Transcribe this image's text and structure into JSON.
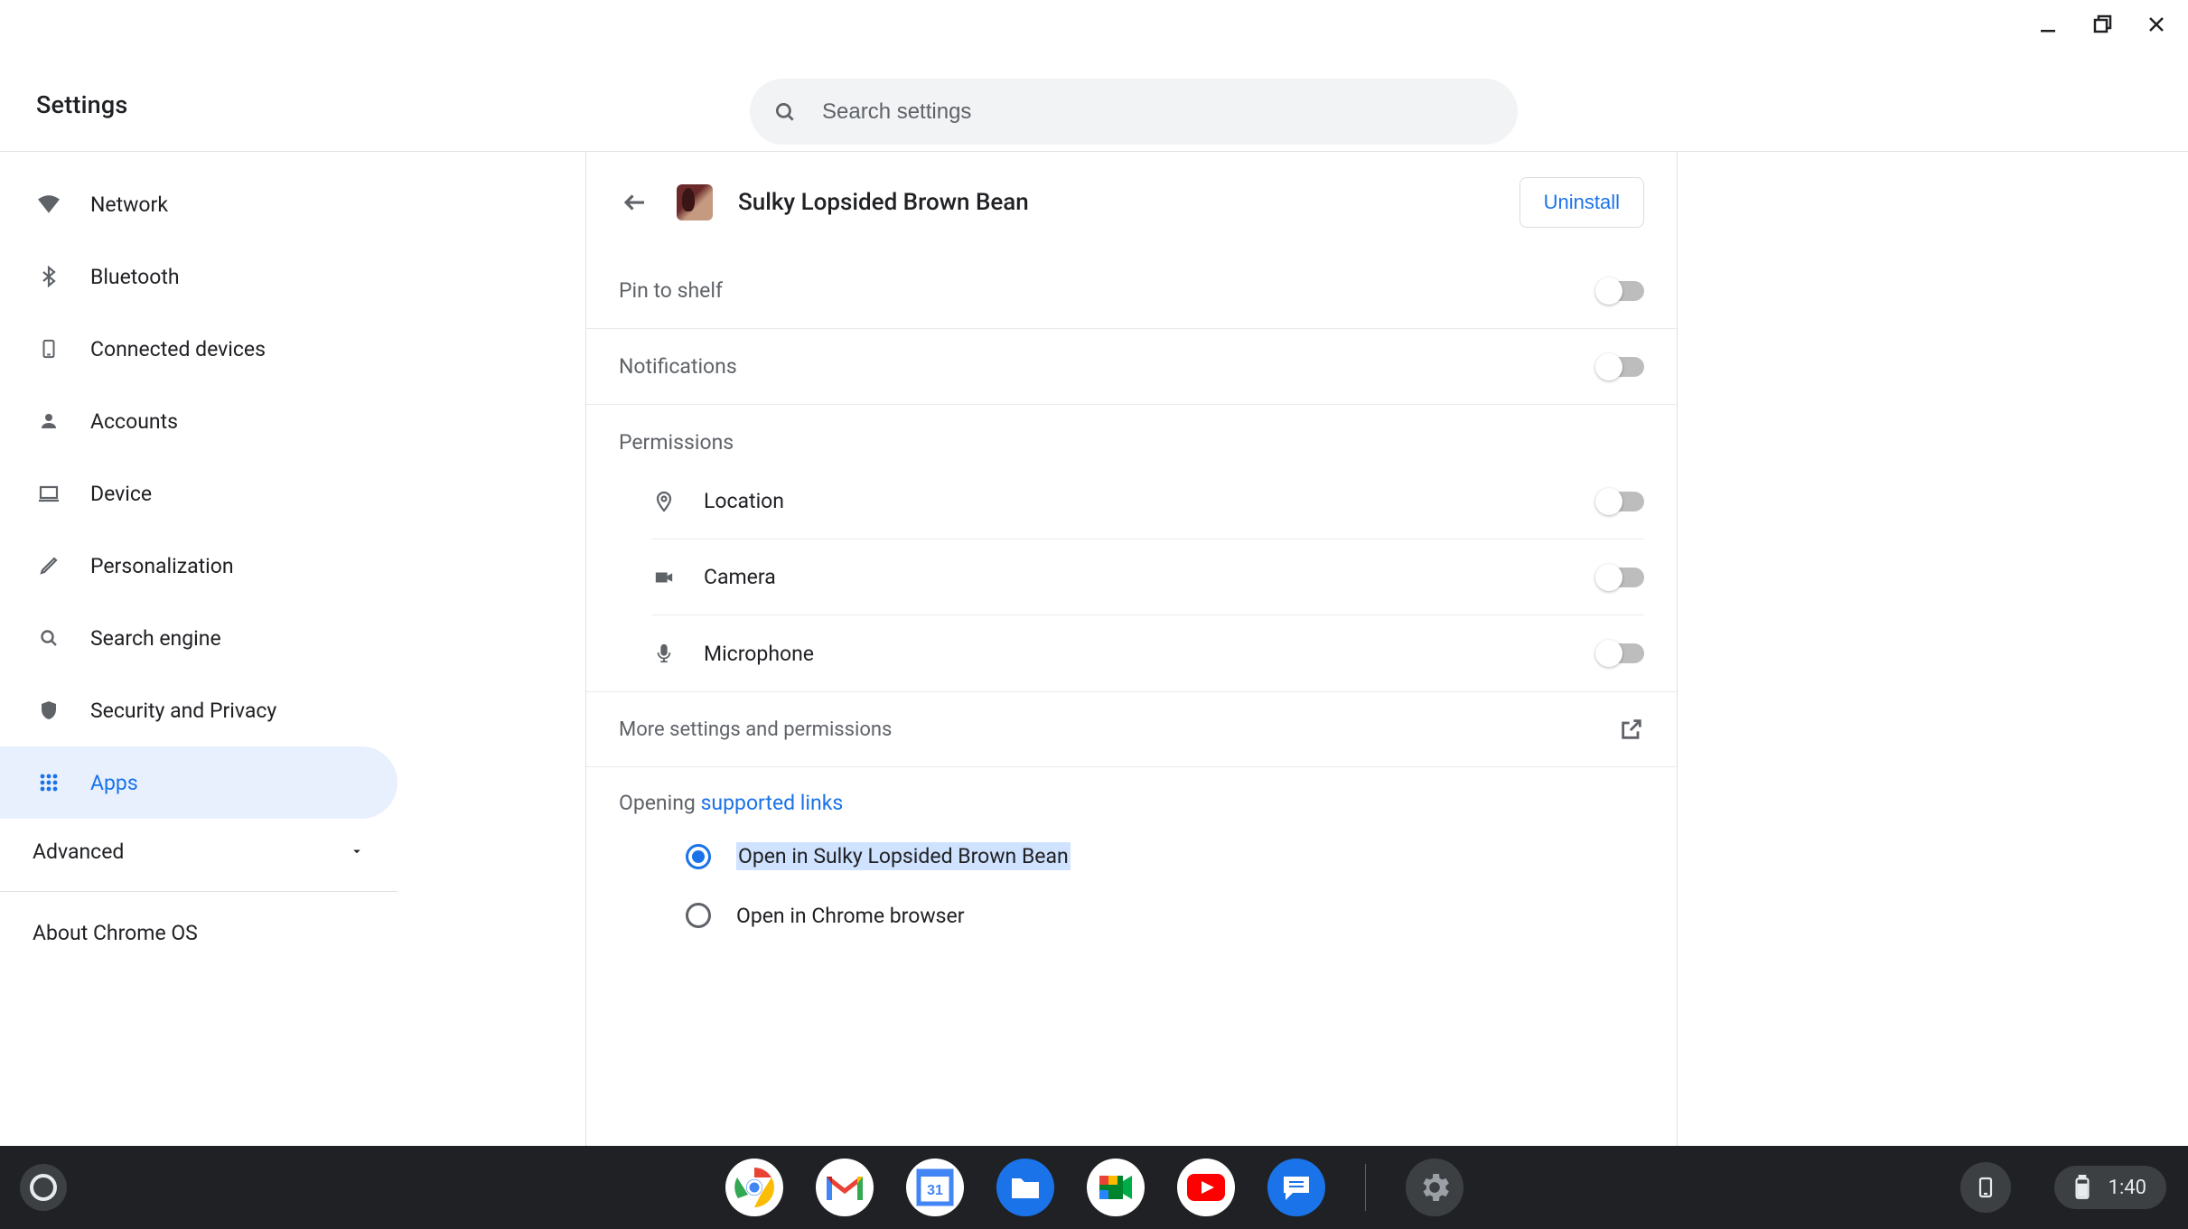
{
  "header": {
    "title": "Settings",
    "search_placeholder": "Search settings"
  },
  "sidebar": {
    "items": [
      {
        "label": "Network"
      },
      {
        "label": "Bluetooth"
      },
      {
        "label": "Connected devices"
      },
      {
        "label": "Accounts"
      },
      {
        "label": "Device"
      },
      {
        "label": "Personalization"
      },
      {
        "label": "Search engine"
      },
      {
        "label": "Security and Privacy"
      },
      {
        "label": "Apps"
      }
    ],
    "advanced_label": "Advanced",
    "about_label": "About Chrome OS"
  },
  "detail": {
    "app_name": "Sulky Lopsided Brown Bean",
    "uninstall_label": "Uninstall",
    "pin_label": "Pin to shelf",
    "notifications_label": "Notifications",
    "permissions_label": "Permissions",
    "permissions": {
      "location": "Location",
      "camera": "Camera",
      "microphone": "Microphone"
    },
    "more_label": "More settings and permissions",
    "opening_prefix": "Opening ",
    "opening_link": "supported links",
    "radio_app": "Open in Sulky Lopsided Brown Bean",
    "radio_chrome": "Open in Chrome browser"
  },
  "shelf": {
    "time": "1:40"
  }
}
